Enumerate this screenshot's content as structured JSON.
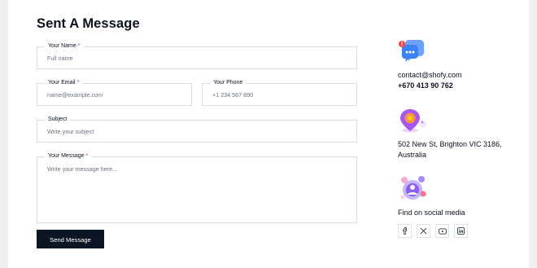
{
  "form": {
    "title": "Sent A Message",
    "required_mark": "*",
    "fields": {
      "name": {
        "label": "Your Name",
        "placeholder": "Full name"
      },
      "email": {
        "label": "Your Email",
        "placeholder": "name@example.com"
      },
      "phone": {
        "label": "Your Phone",
        "placeholder": "+1 234 567 890"
      },
      "subject": {
        "label": "Subject",
        "placeholder": "Write your subject"
      },
      "message": {
        "label": "Your Message",
        "placeholder": "Write your message here..."
      }
    },
    "send_label": "Send Message"
  },
  "contact": {
    "email": "contact@shofy.com",
    "phone": "+670 413 90 762",
    "address_line1": "502 New St, Brighton VIC 3186,",
    "address_line2": "Australia",
    "social_heading": "Find on social media"
  },
  "icons": {
    "message_icon": "chat-bubble-icon",
    "location_icon": "location-pin-icon",
    "social_icon": "social-network-icon",
    "facebook_icon": "facebook-icon",
    "x_icon": "x-twitter-icon",
    "youtube_icon": "youtube-icon",
    "linkedin_icon": "linkedin-icon"
  },
  "colors": {
    "button_bg": "#0b1625",
    "required": "#e11d48",
    "chat_blue": "#3b82f6",
    "accent_purple": "#8b5cf6"
  }
}
